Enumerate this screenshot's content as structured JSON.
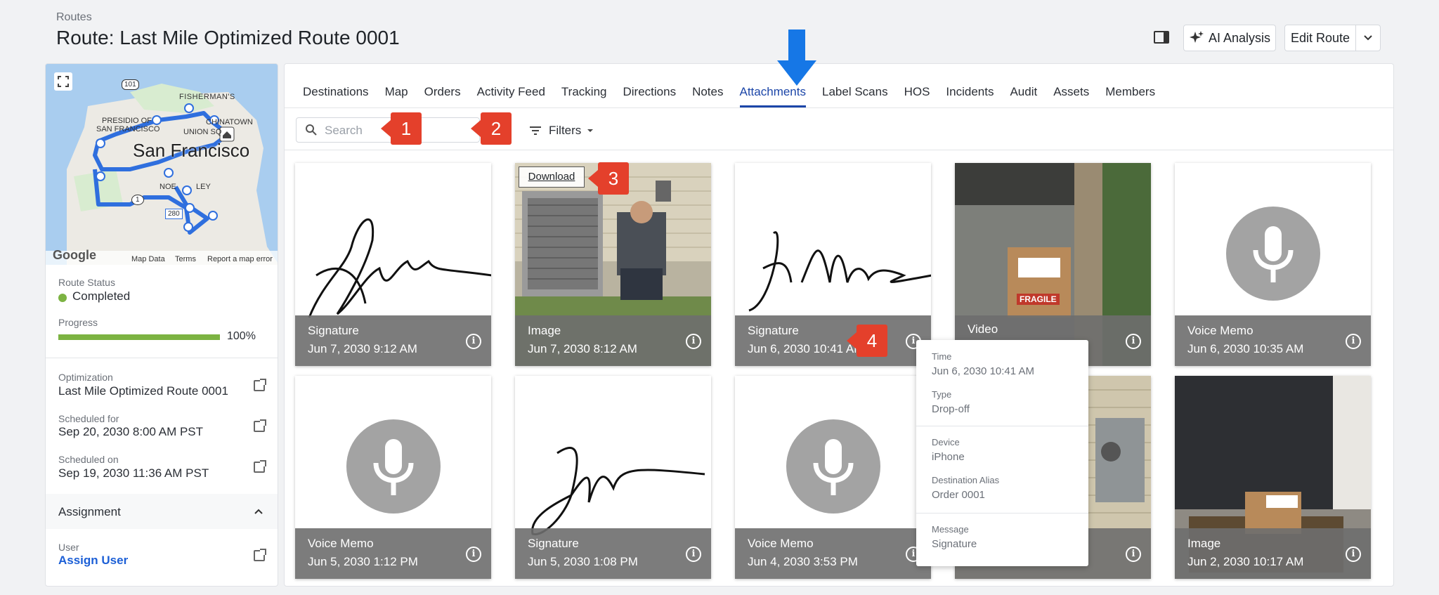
{
  "header": {
    "breadcrumb": "Routes",
    "title": "Route: Last Mile Optimized Route 0001",
    "ai_label": "AI Analysis",
    "edit_label": "Edit Route"
  },
  "map": {
    "city": "San Francisco",
    "labels": [
      "FISHERMAN'S",
      "PRESIDIO OF",
      "SAN FRANCISCO",
      "CHINATOWN",
      "UNION SQ",
      "NOE",
      "LEY"
    ],
    "road_badges": [
      "101",
      "1",
      "280"
    ],
    "footer": [
      "Google",
      "Map Data",
      "Terms",
      "Report a map error"
    ]
  },
  "left": {
    "status_label": "Route Status",
    "status_value": "Completed",
    "progress_label": "Progress",
    "progress_value": "100%",
    "progress_fraction": 1.0,
    "optimization_label": "Optimization",
    "optimization_value": "Last Mile Optimized Route 0001",
    "scheduled_for_label": "Scheduled for",
    "scheduled_for_value": "Sep 20, 2030 8:00 AM PST",
    "scheduled_on_label": "Scheduled on",
    "scheduled_on_value": "Sep 19, 2030 11:36 AM PST",
    "assignment_label": "Assignment",
    "user_label": "User",
    "user_value": "Assign User"
  },
  "tabs": [
    "Destinations",
    "Map",
    "Orders",
    "Activity Feed",
    "Tracking",
    "Directions",
    "Notes",
    "Attachments",
    "Label Scans",
    "HOS",
    "Incidents",
    "Audit",
    "Assets",
    "Members"
  ],
  "active_tab": "Attachments",
  "toolbar": {
    "search_placeholder": "Search",
    "filters_label": "Filters"
  },
  "cards": [
    {
      "type": "Signature",
      "date": "Jun 7, 2030 9:12 AM"
    },
    {
      "type": "Image",
      "date": "Jun 7, 2030 8:12 AM"
    },
    {
      "type": "Signature",
      "date": "Jun 6, 2030 10:41 AM"
    },
    {
      "type": "Video",
      "date": ""
    },
    {
      "type": "Voice Memo",
      "date": "Jun 6, 2030 10:35 AM"
    },
    {
      "type": "Voice Memo",
      "date": "Jun 5, 2030 1:12 PM"
    },
    {
      "type": "Signature",
      "date": "Jun 5, 2030 1:08 PM"
    },
    {
      "type": "Voice Memo",
      "date": "Jun 4, 2030 3:53 PM"
    },
    {
      "type": "",
      "date": ""
    },
    {
      "type": "Image",
      "date": "Jun 2, 2030 10:17 AM"
    }
  ],
  "download_label": "Download",
  "package_label": "FRAGILE",
  "popup": {
    "time_label": "Time",
    "time_value": "Jun 6, 2030 10:41 AM",
    "type_label": "Type",
    "type_value": "Drop-off",
    "device_label": "Device",
    "device_value": "iPhone",
    "alias_label": "Destination Alias",
    "alias_value": "Order 0001",
    "message_label": "Message",
    "message_value": "Signature"
  },
  "markers": [
    "1",
    "2",
    "3",
    "4"
  ],
  "colors": {
    "accent": "#1c46a8",
    "status_green": "#7cb342",
    "marker_red": "#e4402b",
    "arrow_blue": "#1677e6"
  }
}
